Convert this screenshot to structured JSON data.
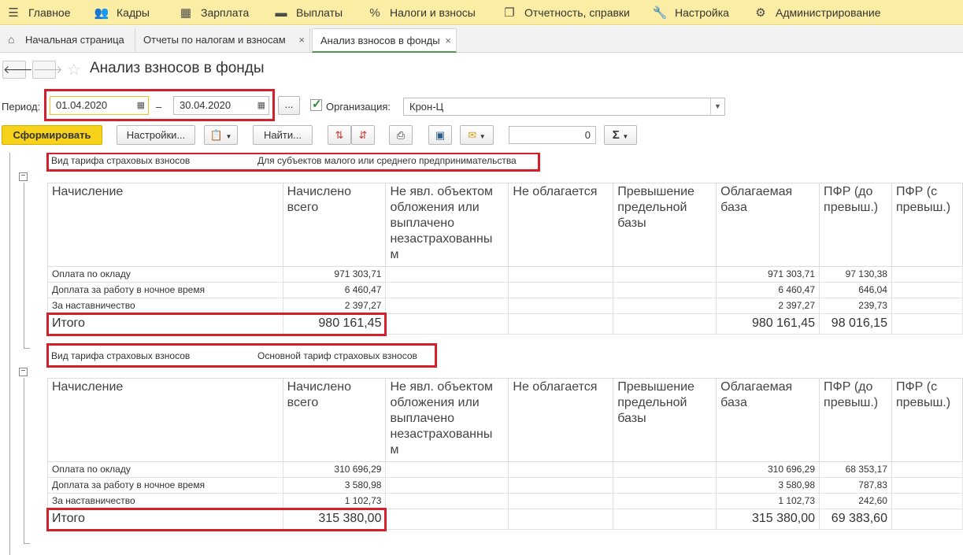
{
  "menu": {
    "items": [
      {
        "label": "Главное",
        "icon": "hamburger-icon",
        "glyph": "☰"
      },
      {
        "label": "Кадры",
        "icon": "people-icon",
        "glyph": "👥"
      },
      {
        "label": "Зарплата",
        "icon": "calculator-icon",
        "glyph": "▦"
      },
      {
        "label": "Выплаты",
        "icon": "wallet-icon",
        "glyph": "▬"
      },
      {
        "label": "Налоги и взносы",
        "icon": "percent-icon",
        "glyph": "%"
      },
      {
        "label": "Отчетность, справки",
        "icon": "documents-icon",
        "glyph": "❐"
      },
      {
        "label": "Настройка",
        "icon": "wrench-icon",
        "glyph": "🔧"
      },
      {
        "label": "Администрирование",
        "icon": "gear-icon",
        "glyph": "⚙"
      }
    ]
  },
  "tabs": [
    {
      "label": "Начальная страница"
    },
    {
      "label": "Отчеты по налогам и взносам"
    },
    {
      "label": "Анализ взносов в фонды"
    }
  ],
  "page": {
    "title": "Анализ взносов в фонды"
  },
  "filters": {
    "period_label": "Период:",
    "date_from": "01.04.2020",
    "date_sep": "–",
    "date_to": "30.04.2020",
    "more_label": "...",
    "org_checked": true,
    "org_label": "Организация:",
    "org_value": "Крон-Ц"
  },
  "toolbar": {
    "generate_label": "Сформировать",
    "settings_label": "Настройки...",
    "find_label": "Найти...",
    "counter_value": "0",
    "sum_label": "Σ"
  },
  "report": {
    "columns": [
      "Начисление",
      "Начислено всего",
      "Не явл. объектом обложения или выплачено незастрахованны м",
      "Не облагается",
      "Превышение предельной базы",
      "Облагаемая база",
      "ПФР (до превыш.)",
      "ПФР (с превыш.)"
    ],
    "groups": [
      {
        "tariff_label": "Вид тарифа страховых взносов",
        "tariff_value": "Для субъектов малого или среднего предпринимательства",
        "rows": [
          {
            "name": "Оплата по окладу",
            "total": "971 303,71",
            "base": "971 303,71",
            "pfr": "97 130,38"
          },
          {
            "name": "Доплата за работу в ночное время",
            "total": "6 460,47",
            "base": "6 460,47",
            "pfr": "646,04"
          },
          {
            "name": "За наставничество",
            "total": "2 397,27",
            "base": "2 397,27",
            "pfr": "239,73"
          }
        ],
        "summary": {
          "label": "Итого",
          "total": "980 161,45",
          "base": "980 161,45",
          "pfr": "98 016,15"
        }
      },
      {
        "tariff_label": "Вид тарифа страховых взносов",
        "tariff_value": "Основной тариф страховых взносов",
        "rows": [
          {
            "name": "Оплата по окладу",
            "total": "310 696,29",
            "base": "310 696,29",
            "pfr": "68 353,17"
          },
          {
            "name": "Доплата за работу в ночное время",
            "total": "3 580,98",
            "base": "3 580,98",
            "pfr": "787,83"
          },
          {
            "name": "За наставничество",
            "total": "1 102,73",
            "base": "1 102,73",
            "pfr": "242,60"
          }
        ],
        "summary": {
          "label": "Итого",
          "total": "315 380,00",
          "base": "315 380,00",
          "pfr": "69 383,60"
        }
      }
    ]
  },
  "colors": {
    "menu_bg": "#fbeda3",
    "primary_button": "#f7d21a",
    "highlight_border": "#d3202a",
    "active_tab_underline": "#4a9a4a"
  }
}
